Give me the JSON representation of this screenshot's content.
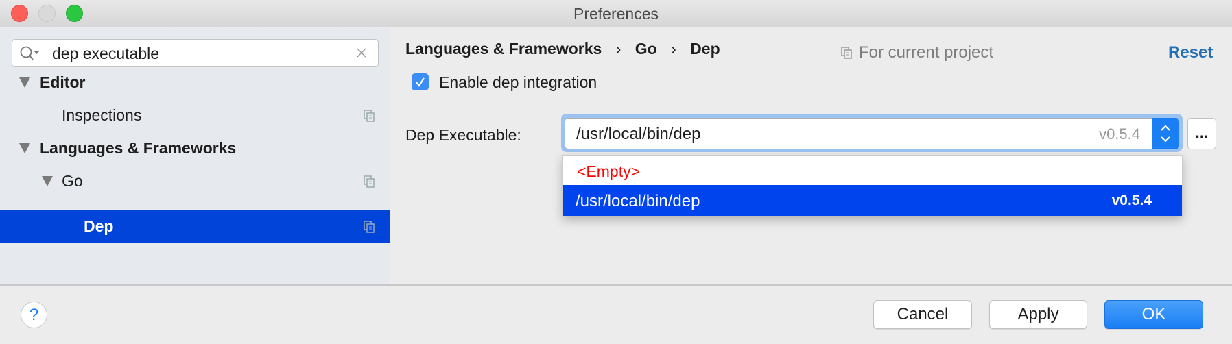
{
  "window": {
    "title": "Preferences"
  },
  "search": {
    "value": "dep executable"
  },
  "tree": [
    {
      "label": "Editor"
    },
    {
      "label": "Inspections"
    },
    {
      "label": "Languages & Frameworks"
    },
    {
      "label": "Go"
    },
    {
      "label": "Dep"
    }
  ],
  "breadcrumb": [
    "Languages & Frameworks",
    "Go",
    "Dep"
  ],
  "breadcrumb_sep": "›",
  "scope_label": "For current project",
  "reset_label": "Reset",
  "enable_checkbox": {
    "label": "Enable dep integration",
    "checked": true
  },
  "executable": {
    "label": "Dep Executable:",
    "value": "/usr/local/bin/dep",
    "version": "v0.5.4",
    "browse_label": "..."
  },
  "dropdown": [
    {
      "label": "<Empty>",
      "version": ""
    },
    {
      "label": "/usr/local/bin/dep",
      "version": "v0.5.4"
    }
  ],
  "footer": {
    "help": "?",
    "cancel": "Cancel",
    "apply": "Apply",
    "ok": "OK"
  },
  "colors": {
    "accent": "#0044d9",
    "ok": "#1a7ff5",
    "link": "#2470b3",
    "error": "#ff0000"
  }
}
